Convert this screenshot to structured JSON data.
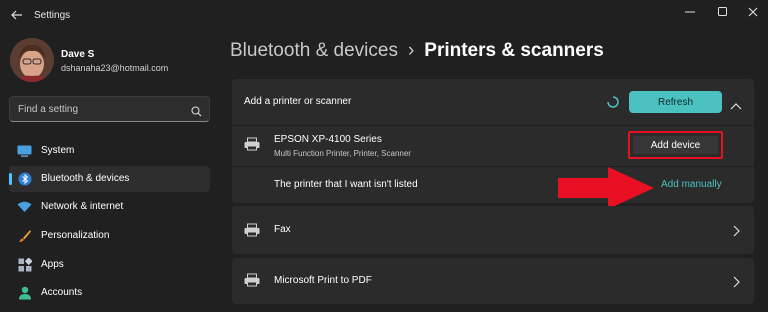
{
  "window": {
    "title": "Settings"
  },
  "profile": {
    "name": "Dave S",
    "email": "dshanaha23@hotmail.com"
  },
  "search": {
    "placeholder": "Find a setting",
    "value": ""
  },
  "sidebar": {
    "items": [
      {
        "label": "System",
        "icon": "system-icon",
        "active": false
      },
      {
        "label": "Bluetooth & devices",
        "icon": "bluetooth-icon",
        "active": true
      },
      {
        "label": "Network & internet",
        "icon": "wifi-icon",
        "active": false
      },
      {
        "label": "Personalization",
        "icon": "brush-icon",
        "active": false
      },
      {
        "label": "Apps",
        "icon": "apps-icon",
        "active": false
      },
      {
        "label": "Accounts",
        "icon": "person-icon",
        "active": false
      }
    ]
  },
  "breadcrumb": {
    "parent": "Bluetooth & devices",
    "separator": "›",
    "current": "Printers & scanners"
  },
  "add_printer": {
    "label": "Add a printer or scanner",
    "refresh_label": "Refresh",
    "device_name": "EPSON XP-4100 Series",
    "device_desc": "Multi Function Printer, Printer, Scanner",
    "add_device_label": "Add device",
    "not_listed_label": "The printer that I want isn't listed",
    "add_manually_label": "Add manually"
  },
  "printers": [
    {
      "name": "Fax",
      "icon": "fax-icon"
    },
    {
      "name": "Microsoft Print to PDF",
      "icon": "printer-icon"
    }
  ],
  "colors": {
    "accent": "#4cc2c0",
    "highlight_red": "#e81123",
    "background": "#202020",
    "card": "#2b2b2b"
  }
}
